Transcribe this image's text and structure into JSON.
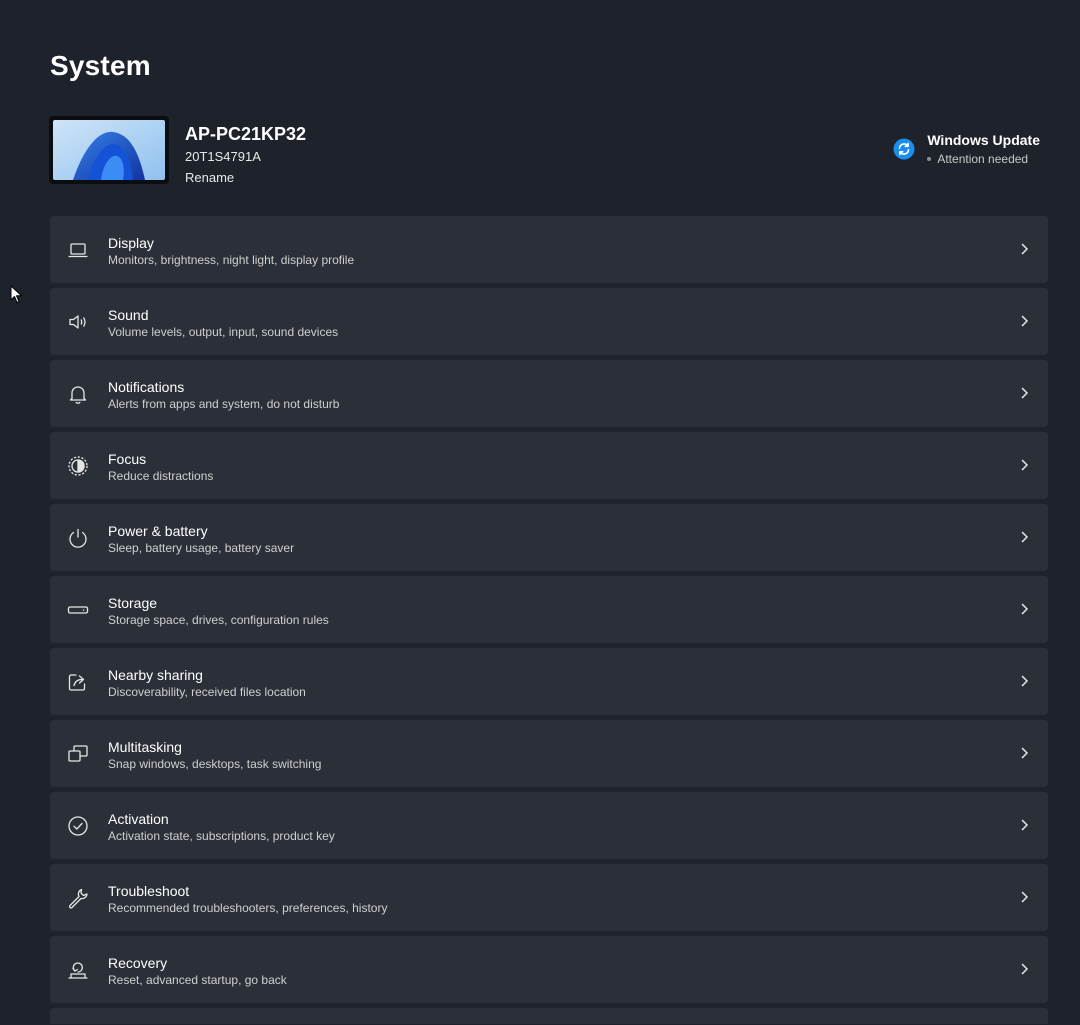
{
  "page": {
    "title": "System"
  },
  "device": {
    "name": "AP-PC21KP32",
    "model": "20T1S4791A",
    "rename_label": "Rename"
  },
  "windows_update": {
    "title": "Windows Update",
    "status": "Attention needed",
    "icon": "sync-icon",
    "accent": "#1a8ff0"
  },
  "settings": [
    {
      "title": "Display",
      "subtitle": "Monitors, brightness, night light, display profile",
      "icon": "laptop-icon"
    },
    {
      "title": "Sound",
      "subtitle": "Volume levels, output, input, sound devices",
      "icon": "speaker-icon"
    },
    {
      "title": "Notifications",
      "subtitle": "Alerts from apps and system, do not disturb",
      "icon": "bell-icon"
    },
    {
      "title": "Focus",
      "subtitle": "Reduce distractions",
      "icon": "focus-icon"
    },
    {
      "title": "Power & battery",
      "subtitle": "Sleep, battery usage, battery saver",
      "icon": "power-icon"
    },
    {
      "title": "Storage",
      "subtitle": "Storage space, drives, configuration rules",
      "icon": "storage-icon"
    },
    {
      "title": "Nearby sharing",
      "subtitle": "Discoverability, received files location",
      "icon": "share-icon"
    },
    {
      "title": "Multitasking",
      "subtitle": "Snap windows, desktops, task switching",
      "icon": "multitasking-icon"
    },
    {
      "title": "Activation",
      "subtitle": "Activation state, subscriptions, product key",
      "icon": "check-circle-icon"
    },
    {
      "title": "Troubleshoot",
      "subtitle": "Recommended troubleshooters, preferences, history",
      "icon": "wrench-icon"
    },
    {
      "title": "Recovery",
      "subtitle": "Reset, advanced startup, go back",
      "icon": "recovery-icon"
    }
  ],
  "colors": {
    "background": "#1e232b",
    "card": "#2b3038",
    "text": "#ffffff",
    "subtext": "#cfcfcf"
  }
}
